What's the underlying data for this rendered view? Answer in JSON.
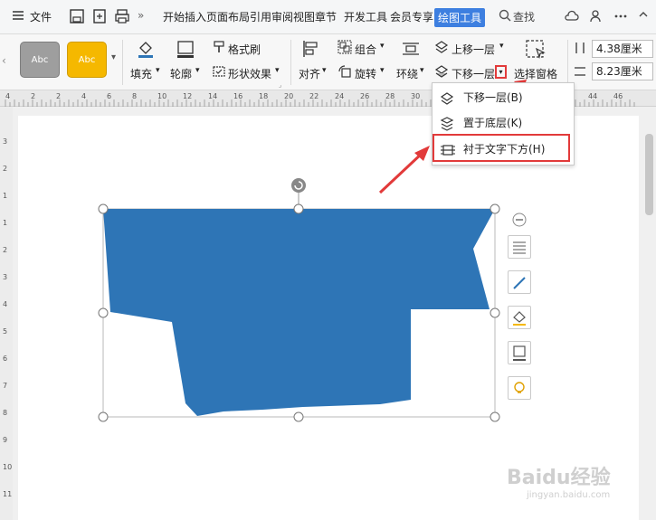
{
  "menubar": {
    "file_label": "文件",
    "tabs": [
      "开始",
      "插入",
      "页面布局",
      "引用",
      "审阅",
      "视图",
      "章节",
      "开发工具",
      "会员专享"
    ],
    "active_tab": "绘图工具",
    "search_label": "查找"
  },
  "ribbon": {
    "style_swatch_1": "Abc",
    "style_swatch_2": "Abc",
    "fill_label": "填充",
    "outline_label": "轮廓",
    "format_painter_label": "格式刷",
    "shape_effects_label": "形状效果",
    "align_label": "对齐",
    "group_label": "组合",
    "rotate_label": "旋转",
    "wrap_label": "环绕",
    "bring_forward_label": "上移一层",
    "send_backward_label": "下移一层",
    "selection_pane_label": "选择窗格",
    "height_value": "4.38厘米",
    "width_value": "8.23厘米",
    "colors": {
      "swatch_gray": "#9e9e9e",
      "swatch_yellow": "#f5b800",
      "accent": "#3d7fe0"
    }
  },
  "dropdown": {
    "items": [
      "下移一层(B)",
      "置于底层(K)",
      "衬于文字下方(H)"
    ]
  },
  "canvas": {
    "shape_color": "#2e75b6"
  },
  "ruler_h": [
    "4",
    "2",
    "2",
    "4",
    "6",
    "8",
    "10",
    "12",
    "14",
    "16",
    "18",
    "20",
    "22",
    "24",
    "26",
    "28",
    "30",
    "32",
    "34",
    "36",
    "38",
    "40",
    "42",
    "44",
    "46"
  ],
  "ruler_v": [
    "3",
    "2",
    "1",
    "1",
    "2",
    "3",
    "4",
    "5",
    "6",
    "7",
    "8",
    "9",
    "10",
    "11"
  ],
  "watermark": {
    "main": "Baidu经验",
    "sub": "jingyan.baidu.com"
  }
}
